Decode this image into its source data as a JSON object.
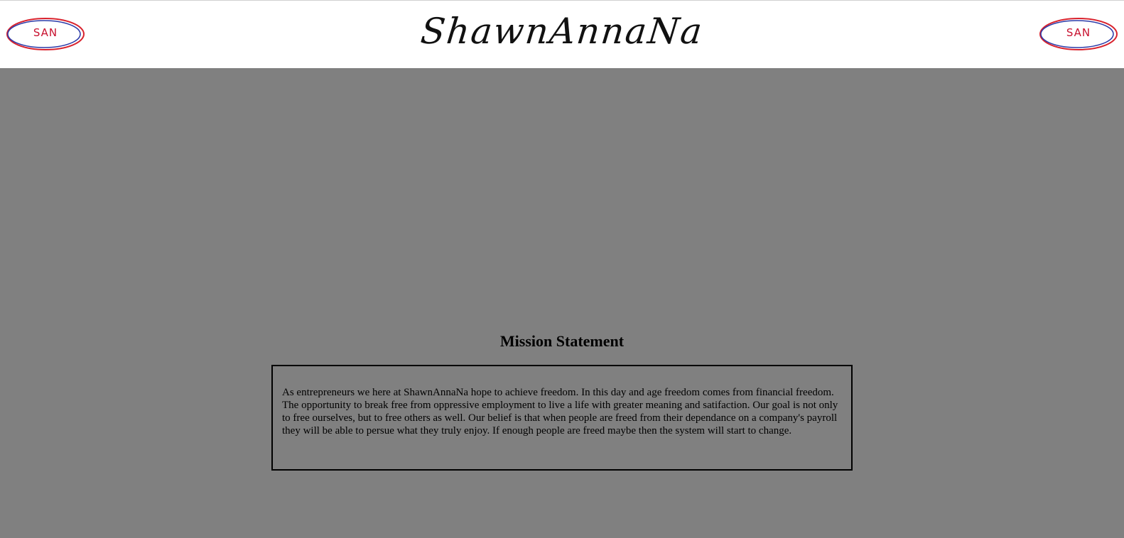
{
  "header": {
    "logo_left_text": "SAN",
    "logo_right_text": "SAN",
    "site_title": "ShawnAnnaNa",
    "logo_colors": {
      "outer_ring": "#d9232e",
      "inner_ring": "#2b3aa8",
      "text": "#c8102e"
    }
  },
  "main": {
    "mission_heading": "Mission Statement",
    "mission_body": "As entrepreneurs we here at ShawnAnnaNa hope to achieve freedom. In this day and age freedom comes from financial freedom. The opportunity to break free from oppressive employment to live a life with greater meaning and satifaction. Our goal is not only to free ourselves, but to free others as well. Our belief is that when people are freed from their dependance on a company's payroll they will be able to persue what they truly enjoy. If enough people are freed maybe then the system will start to change."
  },
  "colors": {
    "header_background": "#ffffff",
    "page_background": "#808080",
    "text": "#000000"
  }
}
